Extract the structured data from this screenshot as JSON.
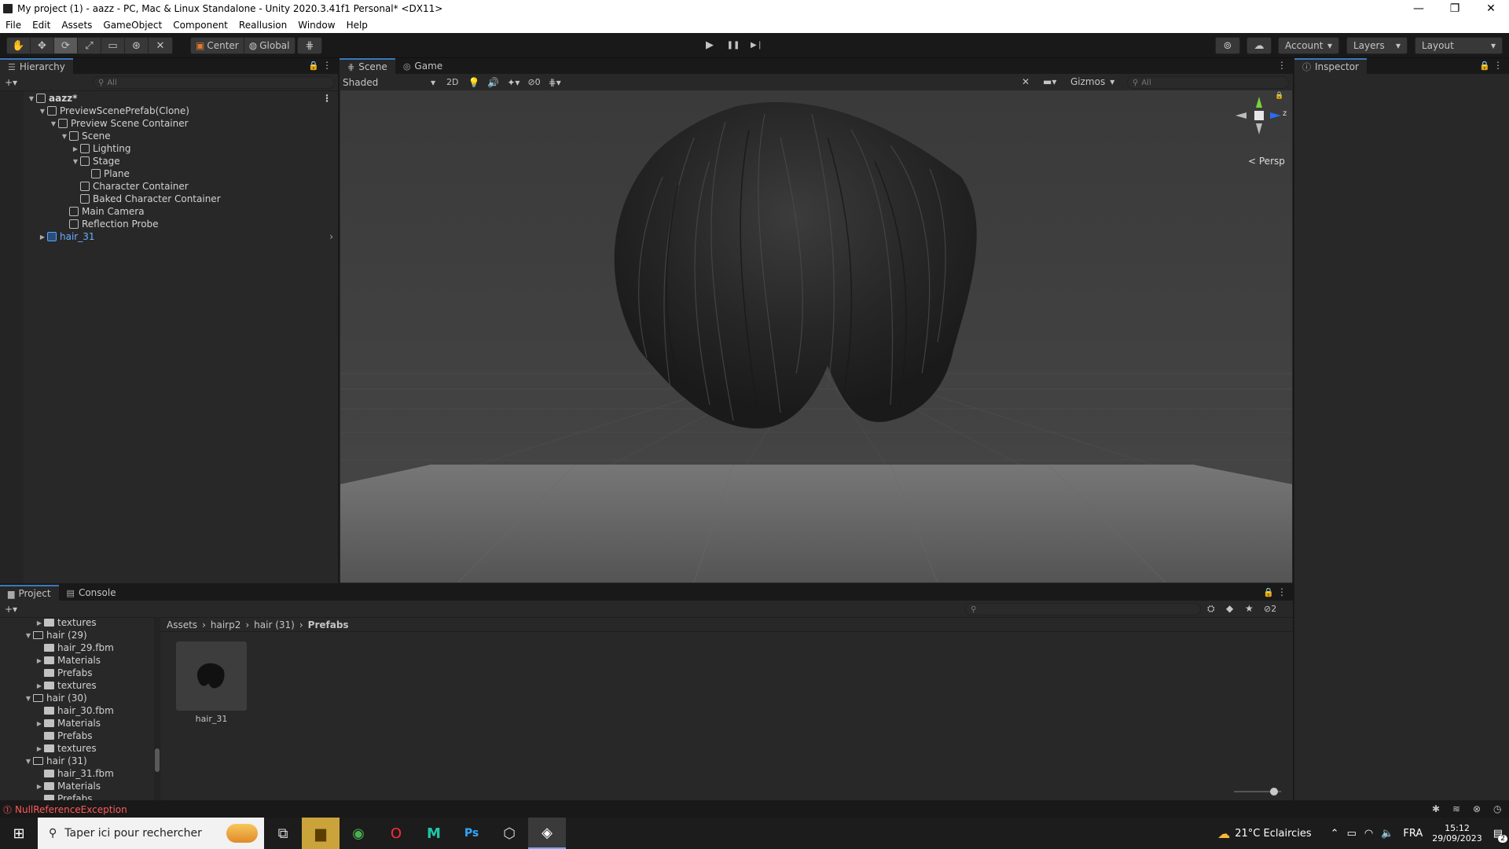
{
  "window": {
    "title": "My project (1) - aazz - PC, Mac & Linux Standalone - Unity 2020.3.41f1 Personal* <DX11>",
    "minimize": "—",
    "maximize": "❐",
    "close": "✕"
  },
  "menu": [
    "File",
    "Edit",
    "Assets",
    "GameObject",
    "Component",
    "Reallusion",
    "Window",
    "Help"
  ],
  "toolbar": {
    "tools": [
      "✋",
      "✥",
      "⟳",
      "⤢",
      "▭",
      "⊛",
      "✕"
    ],
    "pivot": "Center",
    "space": "Global",
    "snap": "⋕",
    "play": "▶",
    "pause": "❚❚",
    "step": "▶❘",
    "services": "⊚",
    "cloud": "☁",
    "account": "Account",
    "layers": "Layers",
    "layout": "Layout"
  },
  "hierarchy": {
    "tab": "Hierarchy",
    "search_placeholder": "All",
    "add": "+▾",
    "items": [
      {
        "label": "aazz*",
        "depth": 0,
        "fold": "▼",
        "bold": true
      },
      {
        "label": "PreviewScenePrefab(Clone)",
        "depth": 1,
        "fold": "▼"
      },
      {
        "label": "Preview Scene Container",
        "depth": 2,
        "fold": "▼"
      },
      {
        "label": "Scene",
        "depth": 3,
        "fold": "▼"
      },
      {
        "label": "Lighting",
        "depth": 4,
        "fold": "▶"
      },
      {
        "label": "Stage",
        "depth": 4,
        "fold": "▼"
      },
      {
        "label": "Plane",
        "depth": 5,
        "fold": ""
      },
      {
        "label": "Character Container",
        "depth": 4,
        "fold": ""
      },
      {
        "label": "Baked Character Container",
        "depth": 4,
        "fold": ""
      },
      {
        "label": "Main Camera",
        "depth": 3,
        "fold": ""
      },
      {
        "label": "Reflection Probe",
        "depth": 3,
        "fold": ""
      },
      {
        "label": "hair_31",
        "depth": 1,
        "fold": "▶",
        "blue": true
      }
    ]
  },
  "scene": {
    "tabs": [
      "Scene",
      "Game"
    ],
    "shading": "Shaded",
    "mode2d": "2D",
    "hidden_count": "0",
    "gizmos": "Gizmos",
    "search_placeholder": "All",
    "persp": "Persp",
    "axis_y": "y",
    "axis_z": "z"
  },
  "inspector": {
    "tab": "Inspector"
  },
  "project": {
    "tabs": [
      "Project",
      "Console"
    ],
    "badge": "2",
    "breadcrumb": [
      "Assets",
      "hairp2",
      "hair (31)",
      "Prefabs"
    ],
    "tree": [
      {
        "label": "textures",
        "depth": 1,
        "fold": "▶",
        "open": false
      },
      {
        "label": "hair (29)",
        "depth": 0,
        "fold": "▼",
        "open": true
      },
      {
        "label": "hair_29.fbm",
        "depth": 1,
        "fold": "",
        "open": false
      },
      {
        "label": "Materials",
        "depth": 1,
        "fold": "▶",
        "open": false
      },
      {
        "label": "Prefabs",
        "depth": 1,
        "fold": "",
        "open": false
      },
      {
        "label": "textures",
        "depth": 1,
        "fold": "▶",
        "open": false
      },
      {
        "label": "hair (30)",
        "depth": 0,
        "fold": "▼",
        "open": true
      },
      {
        "label": "hair_30.fbm",
        "depth": 1,
        "fold": "",
        "open": false
      },
      {
        "label": "Materials",
        "depth": 1,
        "fold": "▶",
        "open": false
      },
      {
        "label": "Prefabs",
        "depth": 1,
        "fold": "",
        "open": false
      },
      {
        "label": "textures",
        "depth": 1,
        "fold": "▶",
        "open": false
      },
      {
        "label": "hair (31)",
        "depth": 0,
        "fold": "▼",
        "open": true
      },
      {
        "label": "hair_31.fbm",
        "depth": 1,
        "fold": "",
        "open": false
      },
      {
        "label": "Materials",
        "depth": 1,
        "fold": "▶",
        "open": false
      },
      {
        "label": "Prefabs",
        "depth": 1,
        "fold": "",
        "open": false,
        "selected": true
      }
    ],
    "asset": "hair_31"
  },
  "status": {
    "error": "NullReferenceException"
  },
  "taskbar": {
    "search_placeholder": "Taper ici pour rechercher",
    "weather": "21°C  Eclaircies",
    "lang": "FRA",
    "time": "15:12",
    "date": "29/09/2023",
    "notif": "2"
  },
  "colors": {
    "accent": "#3a79bb",
    "error": "#ff5a5a",
    "background": "#191919",
    "panel": "#282828"
  }
}
